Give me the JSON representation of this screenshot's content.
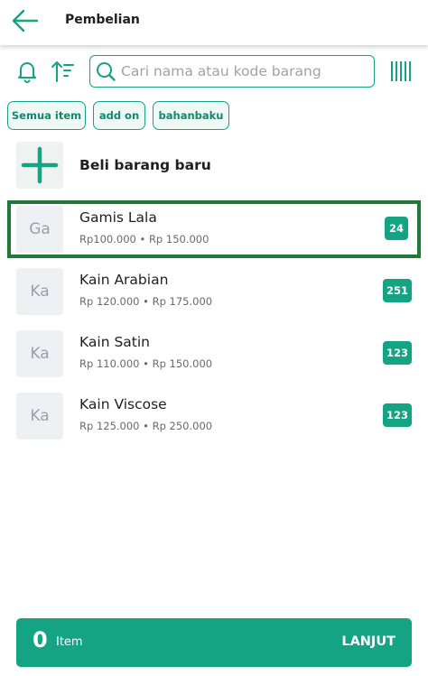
{
  "header": {
    "title": "Pembelian"
  },
  "search": {
    "placeholder": "Cari nama atau kode barang",
    "value": ""
  },
  "filters": [
    {
      "label": "Semua item"
    },
    {
      "label": "add on"
    },
    {
      "label": "bahanbaku"
    }
  ],
  "new_item": {
    "label": "Beli barang baru"
  },
  "items": [
    {
      "initials": "Ga",
      "name": "Gamis Lala",
      "price": "Rp100.000 • Rp 150.000",
      "stock": "24",
      "selected": true
    },
    {
      "initials": "Ka",
      "name": "Kain Arabian",
      "price": "Rp 120.000 • Rp 175.000",
      "stock": "251"
    },
    {
      "initials": "Ka",
      "name": "Kain Satin",
      "price": "Rp 110.000 • Rp 150.000",
      "stock": "123"
    },
    {
      "initials": "Ka",
      "name": "Kain Viscose",
      "price": "Rp 125.000 • Rp 250.000",
      "stock": "123"
    }
  ],
  "footer": {
    "count": "0",
    "count_label": "Item",
    "action_label": "LANJUT"
  },
  "colors": {
    "accent": "#14a383",
    "selection": "#1e7a36"
  }
}
